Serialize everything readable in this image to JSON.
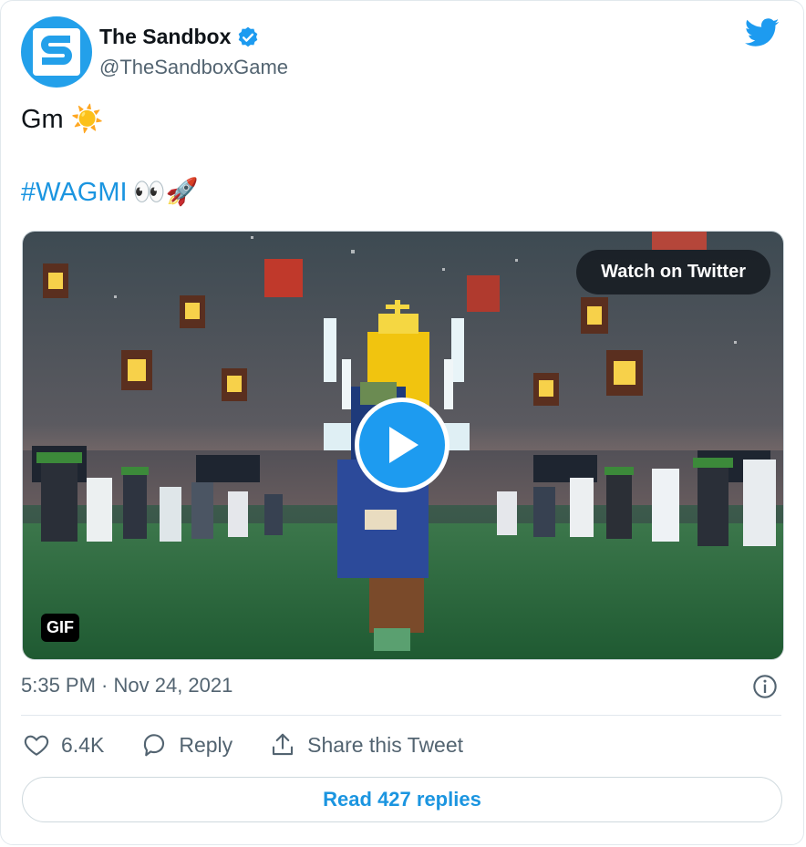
{
  "author": {
    "display_name": "The Sandbox",
    "handle": "@TheSandboxGame"
  },
  "tweet": {
    "line1_text": "Gm",
    "line1_emoji": "☀️",
    "hashtag": "#WAGMI",
    "line2_emoji": "👀🚀"
  },
  "media": {
    "watch_label": "Watch on Twitter",
    "gif_label": "GIF"
  },
  "meta": {
    "timestamp": "5:35 PM · Nov 24, 2021"
  },
  "actions": {
    "likes": "6.4K",
    "reply_label": "Reply",
    "share_label": "Share this Tweet"
  },
  "replies_button": "Read 427 replies",
  "colors": {
    "accent": "#1d9bf0",
    "link": "#1b95e0",
    "secondary_text": "#536471"
  }
}
